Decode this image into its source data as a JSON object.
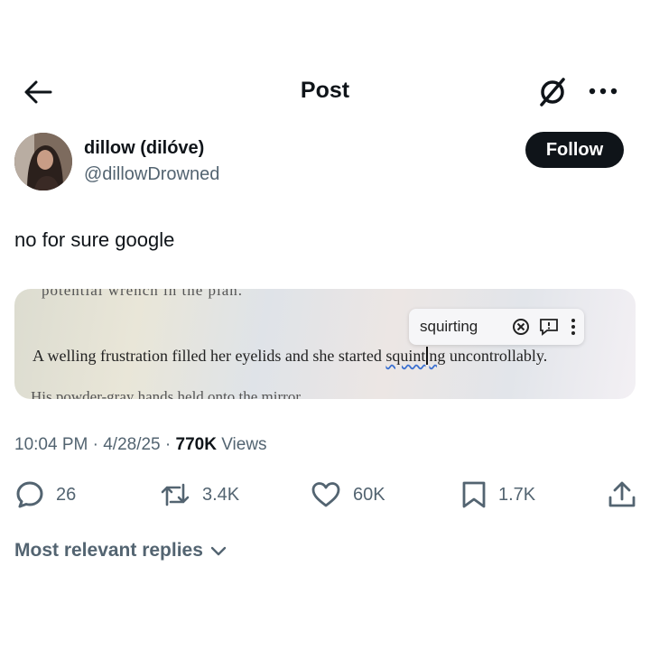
{
  "header": {
    "title": "Post"
  },
  "author": {
    "display_name": "dillow (dilóve)",
    "handle": "@dillowDrowned",
    "follow_label": "Follow"
  },
  "post": {
    "text": "no for sure google"
  },
  "media": {
    "top_fragment": "potential wrench in the plan.",
    "sentence_before": "A welling frustration filled her eyelids and she started ",
    "word_part1": "squint",
    "word_part2": "ng",
    "sentence_after": " uncontrollably.",
    "bottom_fragment": "His powder-gray hands held onto the mirror",
    "suggestion": "squirting"
  },
  "meta": {
    "time": "10:04 PM",
    "date": "4/28/25",
    "views_count": "770K",
    "views_label": "Views"
  },
  "actions": {
    "replies": "26",
    "reposts": "3.4K",
    "likes": "60K",
    "bookmarks": "1.7K"
  },
  "replies_sort": {
    "label": "Most relevant replies"
  }
}
